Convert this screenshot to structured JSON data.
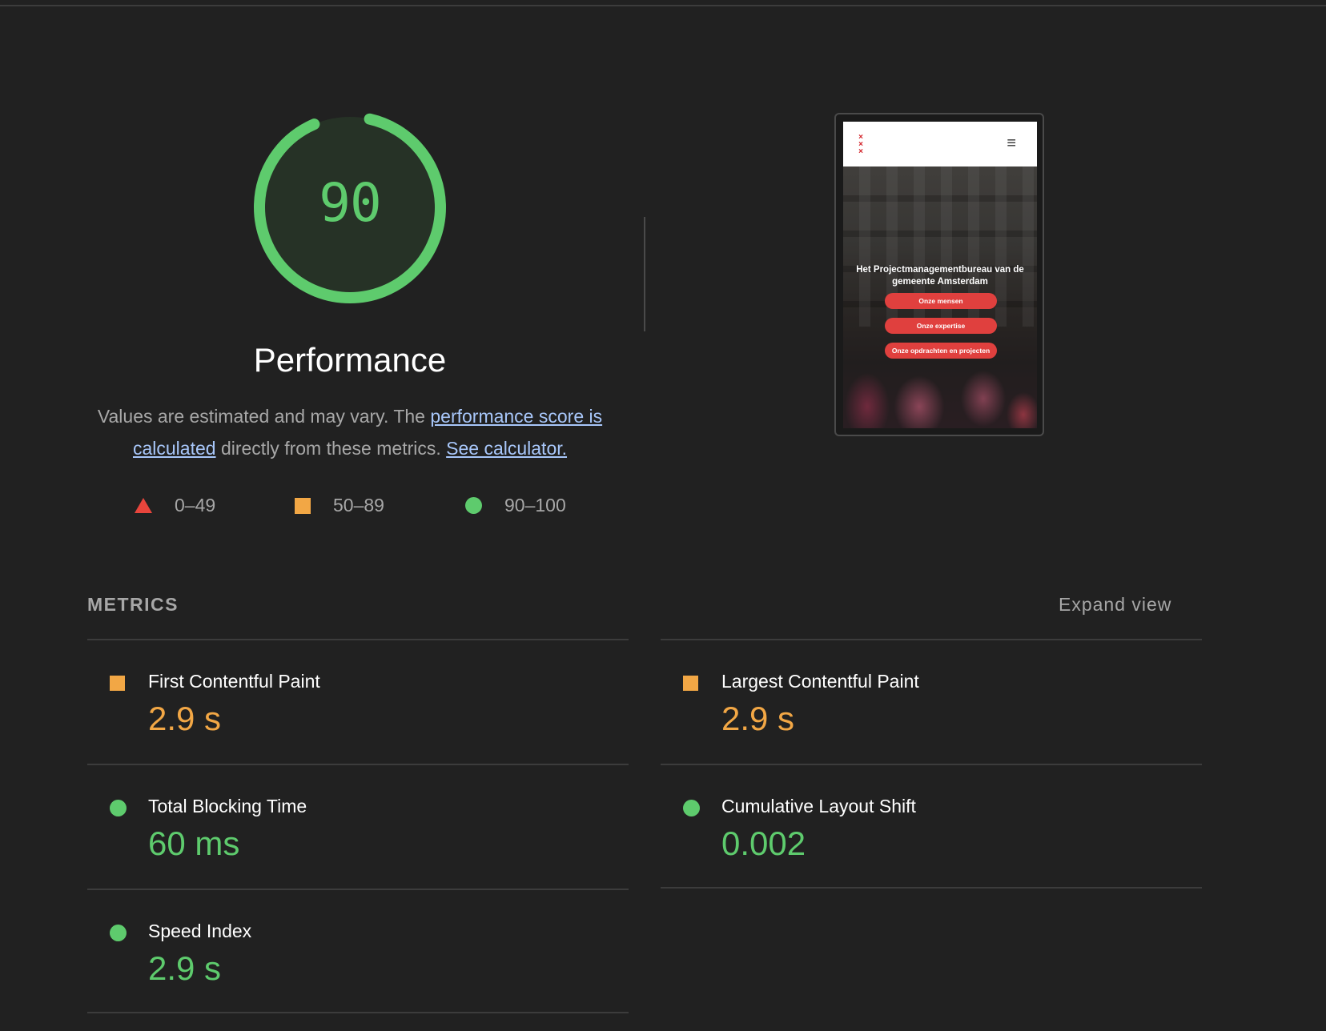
{
  "gauge": {
    "score": "90",
    "score_fraction": 0.9,
    "color": "#5ecb6d",
    "title": "Performance"
  },
  "description": {
    "text_before": "Values are estimated and may vary. The ",
    "link1": "performance score is calculated",
    "text_middle": " directly from these metrics. ",
    "link2": "See calculator."
  },
  "legend": [
    {
      "range": "0–49",
      "icon": "triangle-icon",
      "color": "#e8453c"
    },
    {
      "range": "50–89",
      "icon": "square-icon",
      "color": "#f2a745"
    },
    {
      "range": "90–100",
      "icon": "circle-icon",
      "color": "#5ecb6d"
    }
  ],
  "screenshot": {
    "heading": "Het Projectmanagementbureau van de gemeente Amsterdam",
    "buttons": [
      "Onze mensen",
      "Onze expertise",
      "Onze opdrachten en projecten"
    ],
    "logo": "×\n×\n×",
    "menu_icon": "≡"
  },
  "metrics_section": {
    "label": "METRICS",
    "expand": "Expand view"
  },
  "metrics": [
    {
      "title": "First Contentful Paint",
      "value": "2.9 s",
      "status": "average"
    },
    {
      "title": "Largest Contentful Paint",
      "value": "2.9 s",
      "status": "average"
    },
    {
      "title": "Total Blocking Time",
      "value": "60 ms",
      "status": "pass"
    },
    {
      "title": "Cumulative Layout Shift",
      "value": "0.002",
      "status": "pass"
    },
    {
      "title": "Speed Index",
      "value": "2.9 s",
      "status": "pass"
    }
  ]
}
